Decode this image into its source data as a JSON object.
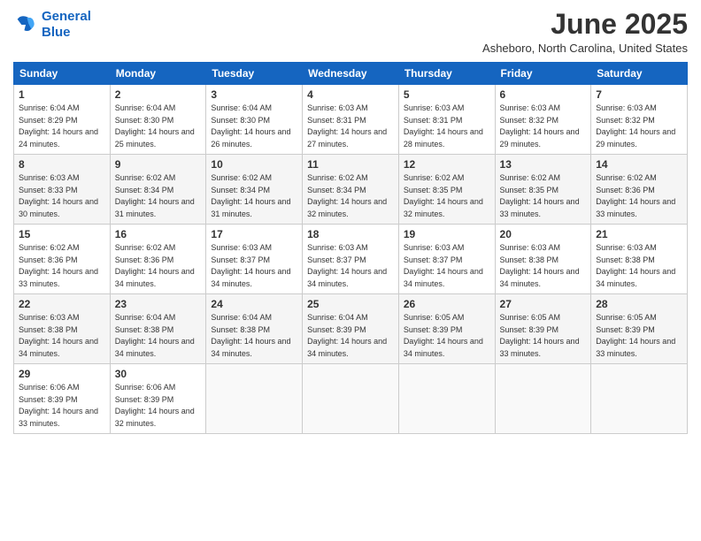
{
  "logo": {
    "line1": "General",
    "line2": "Blue"
  },
  "title": "June 2025",
  "location": "Asheboro, North Carolina, United States",
  "weekdays": [
    "Sunday",
    "Monday",
    "Tuesday",
    "Wednesday",
    "Thursday",
    "Friday",
    "Saturday"
  ],
  "weeks": [
    [
      {
        "day": "1",
        "sunrise": "6:04 AM",
        "sunset": "8:29 PM",
        "daylight": "14 hours and 24 minutes."
      },
      {
        "day": "2",
        "sunrise": "6:04 AM",
        "sunset": "8:30 PM",
        "daylight": "14 hours and 25 minutes."
      },
      {
        "day": "3",
        "sunrise": "6:04 AM",
        "sunset": "8:30 PM",
        "daylight": "14 hours and 26 minutes."
      },
      {
        "day": "4",
        "sunrise": "6:03 AM",
        "sunset": "8:31 PM",
        "daylight": "14 hours and 27 minutes."
      },
      {
        "day": "5",
        "sunrise": "6:03 AM",
        "sunset": "8:31 PM",
        "daylight": "14 hours and 28 minutes."
      },
      {
        "day": "6",
        "sunrise": "6:03 AM",
        "sunset": "8:32 PM",
        "daylight": "14 hours and 29 minutes."
      },
      {
        "day": "7",
        "sunrise": "6:03 AM",
        "sunset": "8:32 PM",
        "daylight": "14 hours and 29 minutes."
      }
    ],
    [
      {
        "day": "8",
        "sunrise": "6:03 AM",
        "sunset": "8:33 PM",
        "daylight": "14 hours and 30 minutes."
      },
      {
        "day": "9",
        "sunrise": "6:02 AM",
        "sunset": "8:34 PM",
        "daylight": "14 hours and 31 minutes."
      },
      {
        "day": "10",
        "sunrise": "6:02 AM",
        "sunset": "8:34 PM",
        "daylight": "14 hours and 31 minutes."
      },
      {
        "day": "11",
        "sunrise": "6:02 AM",
        "sunset": "8:34 PM",
        "daylight": "14 hours and 32 minutes."
      },
      {
        "day": "12",
        "sunrise": "6:02 AM",
        "sunset": "8:35 PM",
        "daylight": "14 hours and 32 minutes."
      },
      {
        "day": "13",
        "sunrise": "6:02 AM",
        "sunset": "8:35 PM",
        "daylight": "14 hours and 33 minutes."
      },
      {
        "day": "14",
        "sunrise": "6:02 AM",
        "sunset": "8:36 PM",
        "daylight": "14 hours and 33 minutes."
      }
    ],
    [
      {
        "day": "15",
        "sunrise": "6:02 AM",
        "sunset": "8:36 PM",
        "daylight": "14 hours and 33 minutes."
      },
      {
        "day": "16",
        "sunrise": "6:02 AM",
        "sunset": "8:36 PM",
        "daylight": "14 hours and 34 minutes."
      },
      {
        "day": "17",
        "sunrise": "6:03 AM",
        "sunset": "8:37 PM",
        "daylight": "14 hours and 34 minutes."
      },
      {
        "day": "18",
        "sunrise": "6:03 AM",
        "sunset": "8:37 PM",
        "daylight": "14 hours and 34 minutes."
      },
      {
        "day": "19",
        "sunrise": "6:03 AM",
        "sunset": "8:37 PM",
        "daylight": "14 hours and 34 minutes."
      },
      {
        "day": "20",
        "sunrise": "6:03 AM",
        "sunset": "8:38 PM",
        "daylight": "14 hours and 34 minutes."
      },
      {
        "day": "21",
        "sunrise": "6:03 AM",
        "sunset": "8:38 PM",
        "daylight": "14 hours and 34 minutes."
      }
    ],
    [
      {
        "day": "22",
        "sunrise": "6:03 AM",
        "sunset": "8:38 PM",
        "daylight": "14 hours and 34 minutes."
      },
      {
        "day": "23",
        "sunrise": "6:04 AM",
        "sunset": "8:38 PM",
        "daylight": "14 hours and 34 minutes."
      },
      {
        "day": "24",
        "sunrise": "6:04 AM",
        "sunset": "8:38 PM",
        "daylight": "14 hours and 34 minutes."
      },
      {
        "day": "25",
        "sunrise": "6:04 AM",
        "sunset": "8:39 PM",
        "daylight": "14 hours and 34 minutes."
      },
      {
        "day": "26",
        "sunrise": "6:05 AM",
        "sunset": "8:39 PM",
        "daylight": "14 hours and 34 minutes."
      },
      {
        "day": "27",
        "sunrise": "6:05 AM",
        "sunset": "8:39 PM",
        "daylight": "14 hours and 33 minutes."
      },
      {
        "day": "28",
        "sunrise": "6:05 AM",
        "sunset": "8:39 PM",
        "daylight": "14 hours and 33 minutes."
      }
    ],
    [
      {
        "day": "29",
        "sunrise": "6:06 AM",
        "sunset": "8:39 PM",
        "daylight": "14 hours and 33 minutes."
      },
      {
        "day": "30",
        "sunrise": "6:06 AM",
        "sunset": "8:39 PM",
        "daylight": "14 hours and 32 minutes."
      },
      null,
      null,
      null,
      null,
      null
    ]
  ],
  "labels": {
    "sunrise": "Sunrise:",
    "sunset": "Sunset:",
    "daylight": "Daylight:"
  }
}
